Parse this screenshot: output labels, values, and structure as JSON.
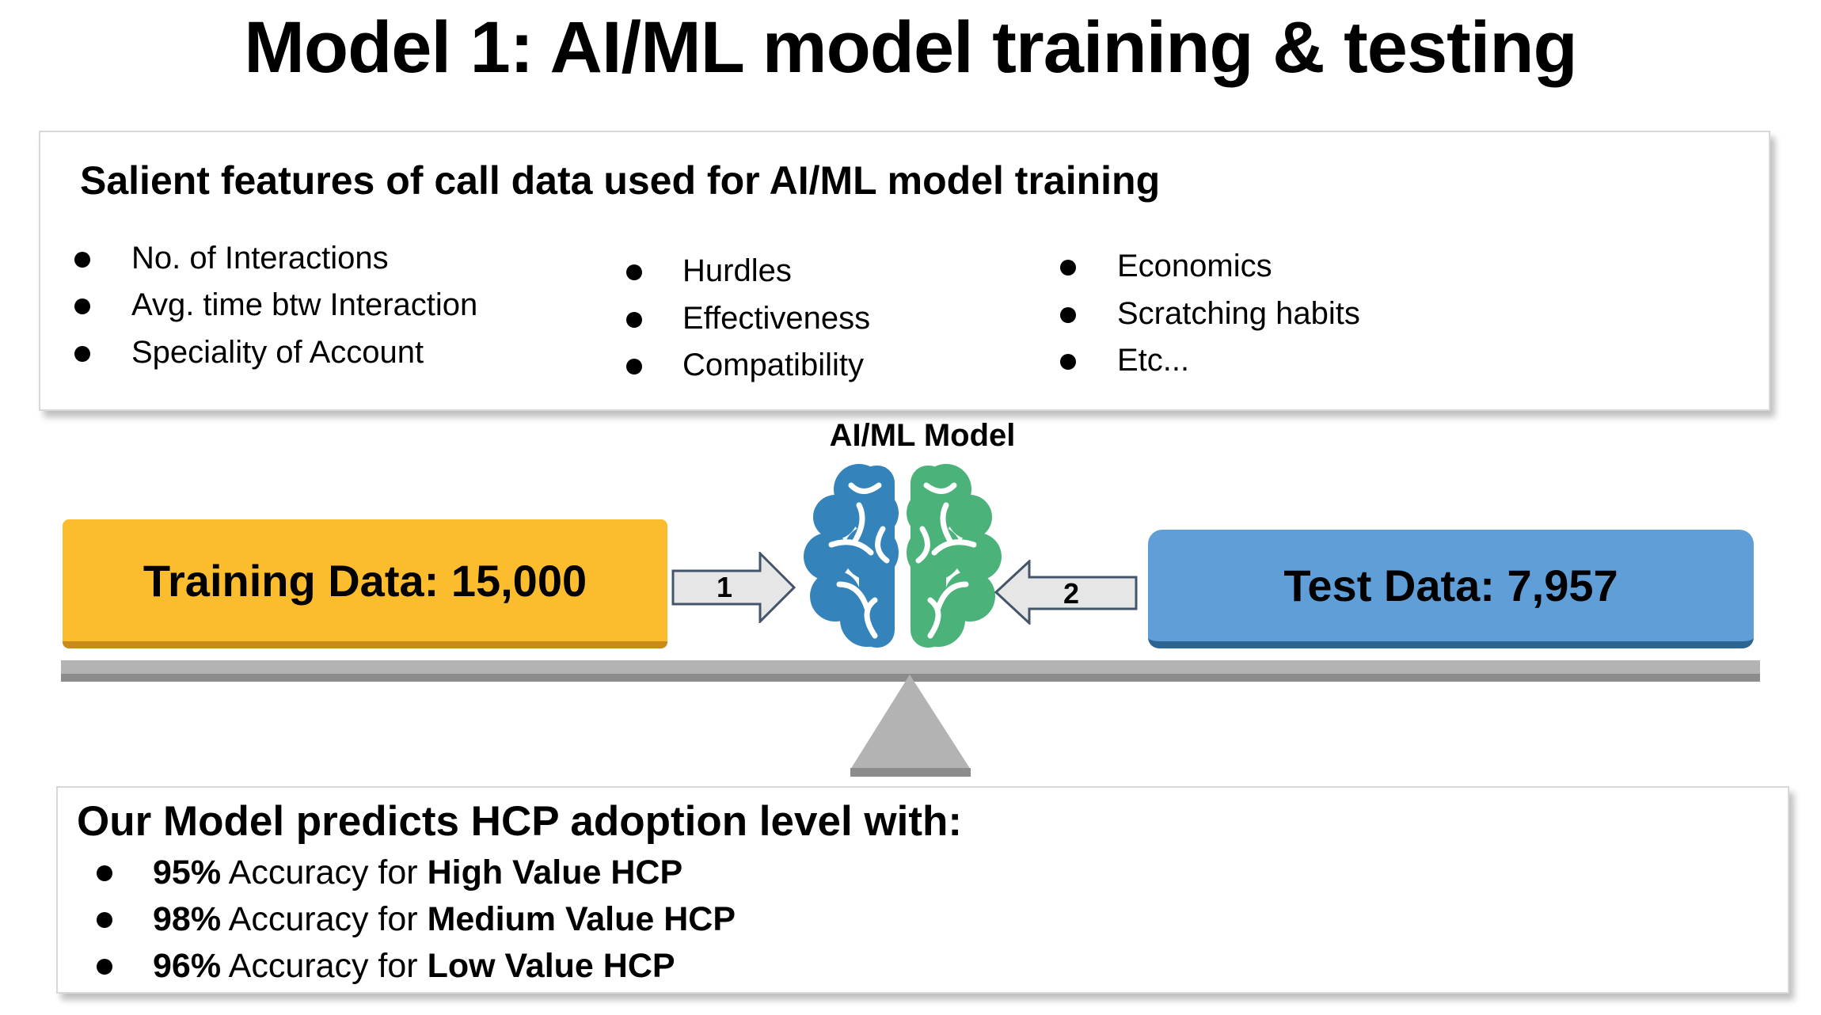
{
  "title": "Model 1: AI/ML model training & testing",
  "features": {
    "heading": "Salient features of call data used for AI/ML model training",
    "columns": [
      [
        "No. of Interactions",
        "Avg. time btw Interaction",
        "Speciality of Account"
      ],
      [
        "Hurdles",
        "Effectiveness",
        "Compatibility"
      ],
      [
        "Economics",
        "Scratching habits",
        "Etc..."
      ]
    ]
  },
  "model": {
    "label": "AI/ML Model",
    "icon": "brain-icon",
    "colors": {
      "left": "#3483BB",
      "right": "#4BB27A"
    }
  },
  "training": {
    "label": "Training Data: 15,000",
    "color": "#FBBC2E"
  },
  "test": {
    "label": "Test Data: 7,957",
    "color": "#5F9ED6"
  },
  "arrows": {
    "one": "1",
    "two": "2"
  },
  "results": {
    "heading": "Our Model predicts HCP adoption level with:",
    "items": [
      {
        "pct": "95%",
        "mid": " Accuracy for ",
        "target": "High Value HCP"
      },
      {
        "pct": "98%",
        "mid": " Accuracy for ",
        "target": "Medium Value HCP"
      },
      {
        "pct": "96%",
        "mid": " Accuracy for ",
        "target": "Low Value HCP"
      }
    ]
  }
}
